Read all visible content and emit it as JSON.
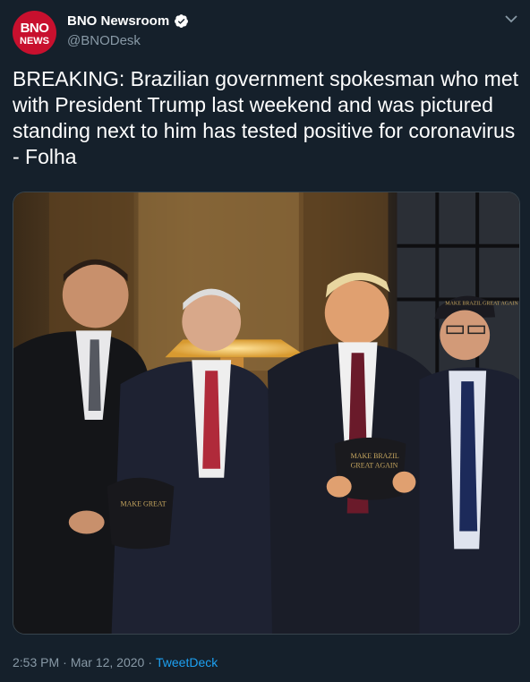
{
  "account": {
    "avatar_line1": "BNO",
    "avatar_line2": "NEWS",
    "name": "BNO Newsroom",
    "handle": "@BNODesk"
  },
  "icons": {
    "verified": "verified-badge-icon",
    "menu": "chevron-down-icon"
  },
  "tweet": {
    "text": "BREAKING: Brazilian government spokesman who met with President Trump last weekend and was pictured standing next to him has tested positive for coronavirus - Folha"
  },
  "photo": {
    "hat_text_left": "MAKE GREAT",
    "hat_text_center_1": "MAKE BRAZIL",
    "hat_text_center_2": "GREAT AGAIN",
    "hat_text_right": "MAKE BRAZIL GREAT AGAIN"
  },
  "meta": {
    "time": "2:53 PM",
    "separator": "·",
    "date": "Mar 12, 2020",
    "source": "TweetDeck"
  },
  "colors": {
    "background": "#15202b",
    "secondary_text": "#8899a6",
    "link": "#1da1f2",
    "avatar": "#c8102e"
  }
}
